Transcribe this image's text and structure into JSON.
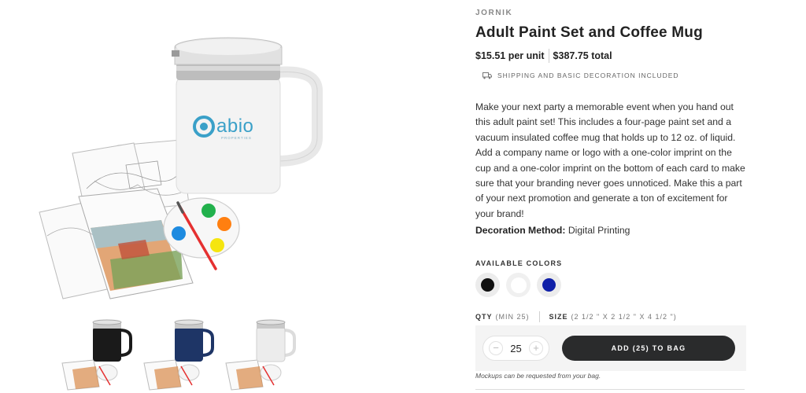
{
  "product": {
    "brand": "JORNIK",
    "title": "Adult Paint Set and Coffee Mug",
    "price_unit": "$15.51 per unit",
    "price_total": "$387.75 total",
    "shipping": "SHIPPING AND BASIC DECORATION INCLUDED",
    "description": "Make your next party a memorable event when you hand out this adult paint set! This includes a four-page paint set and a vacuum insulated coffee mug that holds up to 12 oz. of liquid. Add a company name or logo with a one-color imprint on the cup and a one-color imprint on the bottom of each card to make sure that your branding never goes unnoticed. Make this a part of your next promotion and generate a ton of excitement for your brand!",
    "decoration_label": "Decoration Method:",
    "decoration_value": "Digital Printing",
    "logo_text": "abio",
    "logo_sub": "PROPERTIES"
  },
  "colors": {
    "label": "AVAILABLE COLORS",
    "items": [
      {
        "name": "Black",
        "hex": "#111111"
      },
      {
        "name": "White",
        "hex": "#ffffff"
      },
      {
        "name": "Navy",
        "hex": "#1020a8"
      }
    ],
    "selected": "White"
  },
  "order": {
    "qty_label": "QTY",
    "qty_min": "(MIN 25)",
    "size_label": "SIZE",
    "size_value": "(2 1/2 \" X 2 1/2 \" X 4 1/2 \")",
    "qty_value": "25",
    "minus": "−",
    "plus": "+",
    "add_button": "ADD (25) TO BAG",
    "mockups_note": "Mockups can be requested from your bag."
  },
  "thumbnails": [
    {
      "label": "black-mug",
      "color": "#1a1a1a"
    },
    {
      "label": "navy-mug",
      "color": "#1e3566"
    },
    {
      "label": "white-mug",
      "color": "#e6e6e6"
    }
  ],
  "theme": {
    "button_bg": "#2a2b2c",
    "palette_paints": [
      "#22b14c",
      "#ff7f10",
      "#1e8be0",
      "#f5e50f"
    ],
    "logo_color": "#3aa0c8"
  }
}
